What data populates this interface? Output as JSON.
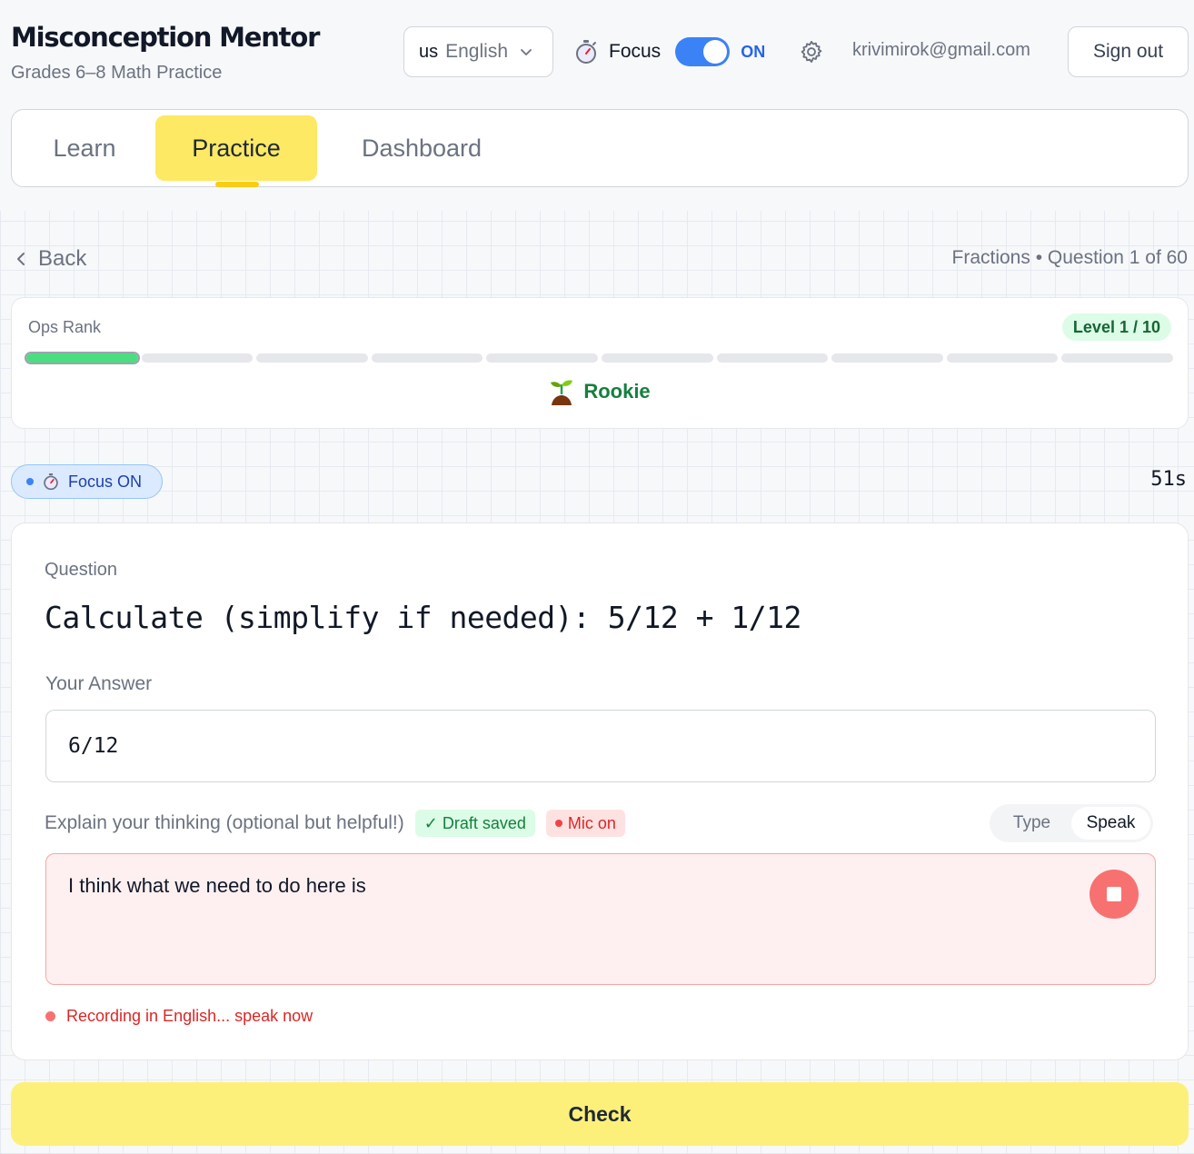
{
  "app": {
    "title": "Misconception Mentor",
    "subtitle": "Grades 6–8 Math Practice"
  },
  "header": {
    "language": {
      "flag": "us",
      "selected": "English"
    },
    "focus": {
      "label": "Focus",
      "state": "ON",
      "enabled": true
    },
    "email": "krivimirok@gmail.com",
    "sign_out_label": "Sign out"
  },
  "tabs": [
    {
      "label": "Learn",
      "active": false
    },
    {
      "label": "Practice",
      "active": true
    },
    {
      "label": "Dashboard",
      "active": false
    }
  ],
  "nav": {
    "back_label": "Back",
    "breadcrumb": "Fractions • Question 1 of 60"
  },
  "rank": {
    "label": "Ops Rank",
    "level_badge": "Level 1 / 10",
    "level": 1,
    "max_level": 10,
    "name": "Rookie",
    "icon": "seedling-icon",
    "fill_color": "#4ade80"
  },
  "session": {
    "focus_pill": "Focus ON",
    "timer": "51s"
  },
  "question": {
    "label": "Question",
    "text": "Calculate (simplify if needed): 5/12 + 1/12",
    "answer_label": "Your Answer",
    "answer_value": "6/12",
    "explain_label": "Explain your thinking (optional but helpful!)",
    "draft_badge": "✓ Draft saved",
    "mic_badge": "Mic on",
    "mode_options": [
      "Type",
      "Speak"
    ],
    "mode_selected": "Speak",
    "explain_text": "I think what we need to do here is",
    "recording_status": "Recording in English... speak now"
  },
  "actions": {
    "check_label": "Check"
  },
  "colors": {
    "accent_yellow": "#fde963",
    "accent_blue": "#3b82f6",
    "recording_red": "#f87171"
  }
}
